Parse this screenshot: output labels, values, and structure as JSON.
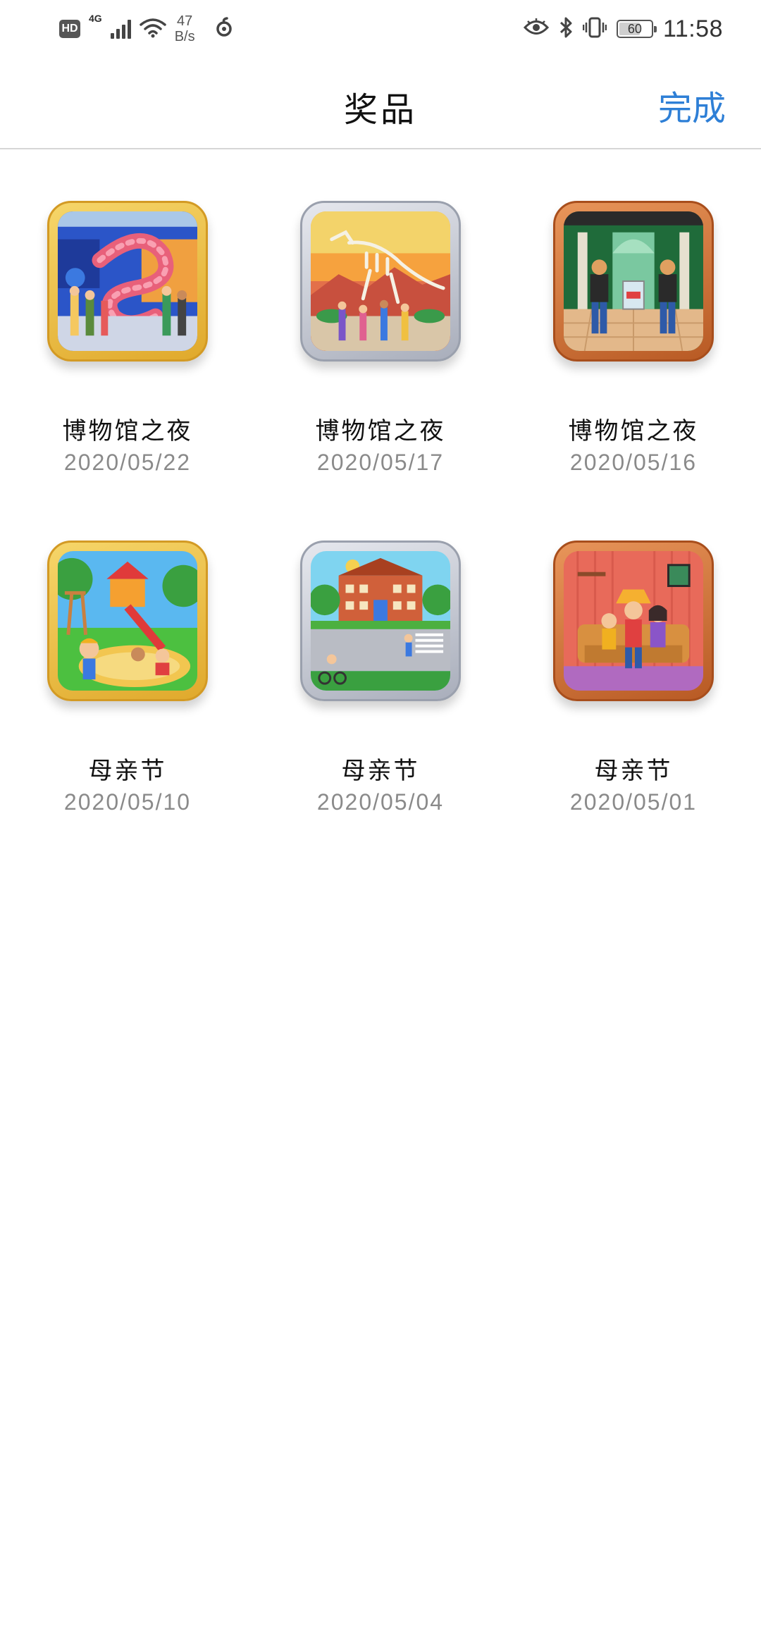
{
  "status_bar": {
    "hd_label": "HD",
    "network": "4G",
    "speed_value": "47",
    "speed_unit": "B/s",
    "battery_level": "60",
    "time": "11:58",
    "icons": [
      "hd-icon",
      "signal-icon",
      "wifi-icon",
      "data-speed",
      "swirl-icon",
      "eye-icon",
      "bluetooth-icon",
      "vibrate-icon",
      "battery-icon"
    ]
  },
  "header": {
    "title": "奖品",
    "done_label": "完成"
  },
  "colors": {
    "accent": "#2e7fd6",
    "title": "#111111",
    "date": "#8a8a8a",
    "divider": "#d6d6d6"
  },
  "awards": [
    {
      "title": "博物馆之夜",
      "date": "2020/05/22",
      "frame": "gold",
      "scene": "museum-snake"
    },
    {
      "title": "博物馆之夜",
      "date": "2020/05/17",
      "frame": "silver",
      "scene": "museum-dinosaur"
    },
    {
      "title": "博物馆之夜",
      "date": "2020/05/16",
      "frame": "bronze",
      "scene": "museum-guards"
    },
    {
      "title": "母亲节",
      "date": "2020/05/10",
      "frame": "gold",
      "scene": "playground"
    },
    {
      "title": "母亲节",
      "date": "2020/05/04",
      "frame": "silver",
      "scene": "school"
    },
    {
      "title": "母亲节",
      "date": "2020/05/01",
      "frame": "bronze",
      "scene": "family-sofa"
    }
  ]
}
